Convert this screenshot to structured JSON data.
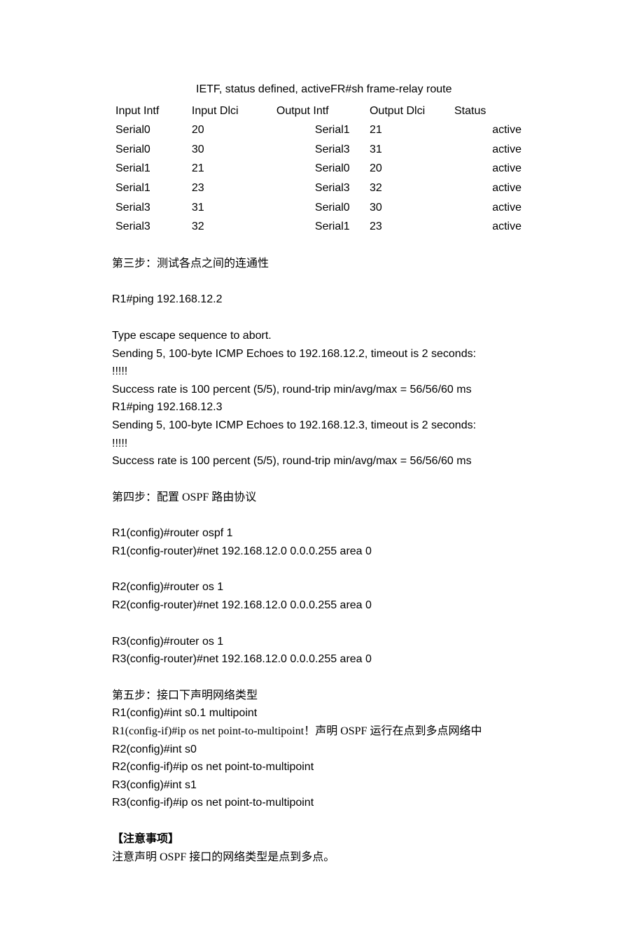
{
  "frameRelay": {
    "titleLine": "IETF, status defined, activeFR#sh frame-relay route",
    "headers": {
      "inputIntf": "Input Intf",
      "inputDlci": "Input Dlci",
      "outputIntf": "Output Intf",
      "outputDlci": "Output Dlci",
      "status": "Status"
    },
    "rows": [
      {
        "ii": "Serial0",
        "id": "20",
        "oi": "Serial1",
        "od": "21",
        "st": "active"
      },
      {
        "ii": "Serial0",
        "id": "30",
        "oi": "Serial3",
        "od": "31",
        "st": "active"
      },
      {
        "ii": "Serial1",
        "id": "21",
        "oi": "Serial0",
        "od": "20",
        "st": "active"
      },
      {
        "ii": "Serial1",
        "id": "23",
        "oi": "Serial3",
        "od": "32",
        "st": "active"
      },
      {
        "ii": "Serial3",
        "id": "31",
        "oi": "Serial0",
        "od": "30",
        "st": "active"
      },
      {
        "ii": "Serial3",
        "id": "32",
        "oi": "Serial1",
        "od": "23",
        "st": "active"
      }
    ]
  },
  "step3": {
    "title": "第三步：测试各点之间的连通性",
    "cmd1": "R1#ping 192.168.12.2",
    "esc": "Type escape sequence to abort.",
    "send1": "Sending 5, 100-byte ICMP Echoes to 192.168.12.2, timeout is 2 seconds:",
    "bang": "!!!!!",
    "succ1": "Success rate is 100 percent (5/5), round-trip min/avg/max = 56/56/60 ms",
    "cmd2": "R1#ping 192.168.12.3",
    "send2": "Sending 5, 100-byte ICMP Echoes to 192.168.12.3, timeout is 2 seconds:",
    "succ2": "Success rate is 100 percent (5/5), round-trip min/avg/max = 56/56/60 ms"
  },
  "step4": {
    "title": "第四步：配置 OSPF 路由协议",
    "r1a": "R1(config)#router ospf 1",
    "r1b": "R1(config-router)#net 192.168.12.0 0.0.0.255 area 0",
    "r2a": "R2(config)#router os 1",
    "r2b": "R2(config-router)#net 192.168.12.0 0.0.0.255 area 0",
    "r3a": "R3(config)#router os 1",
    "r3b": "R3(config-router)#net 192.168.12.0 0.0.0.255 area 0"
  },
  "step5": {
    "title": "第五步：接口下声明网络类型",
    "l1": "R1(config)#int s0.1 multipoint",
    "l2": "R1(config-if)#ip os net point-to-multipoint！声明 OSPF 运行在点到多点网络中",
    "l3": "R2(config)#int s0",
    "l4": "R2(config-if)#ip os net point-to-multipoint",
    "l5": "R3(config)#int s1",
    "l6": "R3(config-if)#ip os net point-to-multipoint"
  },
  "notes": {
    "title": "【注意事项】",
    "body": "注意声明 OSPF 接口的网络类型是点到多点。"
  }
}
